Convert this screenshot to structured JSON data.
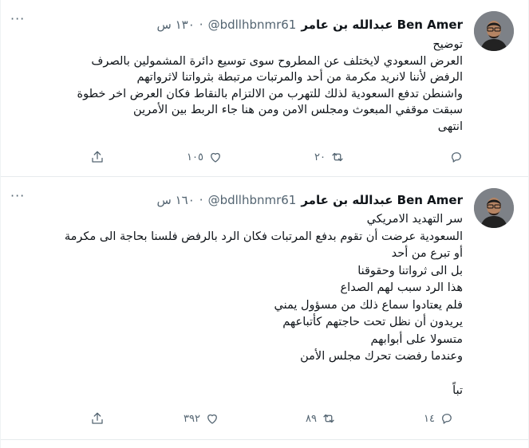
{
  "tweets": [
    {
      "name": "عبدالله بن عامر Ben Amer",
      "handle": "@bdllhbnmr61",
      "dot": "·",
      "time": "١٣٠ س",
      "more": "···",
      "lines": [
        "توضيح",
        "العرض السعودي لايختلف عن المطروح سوى توسيع دائرة المشمولين بالصرف",
        "الرفض لأننا لانريد مكرمة من أحد والمرتبات مرتبطة بثرواتنا لاثرواتهم",
        "واشنطن تدفع السعودية لذلك للتهرب من الالتزام بالنقاط فكان العرض اخر خطوة",
        "سبقت موقفي المبعوث ومجلس الامن ومن هنا جاء الربط بين الأمرين",
        "انتهى"
      ],
      "reply_count": "",
      "retweet_count": "٢٠",
      "like_count": "١٠٥"
    },
    {
      "name": "عبدالله بن عامر Ben Amer",
      "handle": "@bdllhbnmr61",
      "dot": "·",
      "time": "١٦٠ س",
      "more": "···",
      "lines": [
        "سر التهديد الامريكي",
        "السعودية عرضت أن تقوم بدفع المرتبات فكان الرد بالرفض فلسنا بحاجة الى مكرمة",
        "أو تبرع من أحد",
        "بل الى ثرواتنا وحقوقنا",
        "هذا الرد سبب لهم الصداع",
        "فلم يعتادوا سماع ذلك من مسؤول يمني",
        "يريدون أن نظل تحت حاجتهم كأتباعهم",
        "متسولا على أبوابهم",
        "وعندما رفضت تحرك مجلس الأمن",
        "",
        "تباً"
      ],
      "reply_count": "١٤",
      "retweet_count": "٨٩",
      "like_count": "٣٩٢"
    }
  ]
}
